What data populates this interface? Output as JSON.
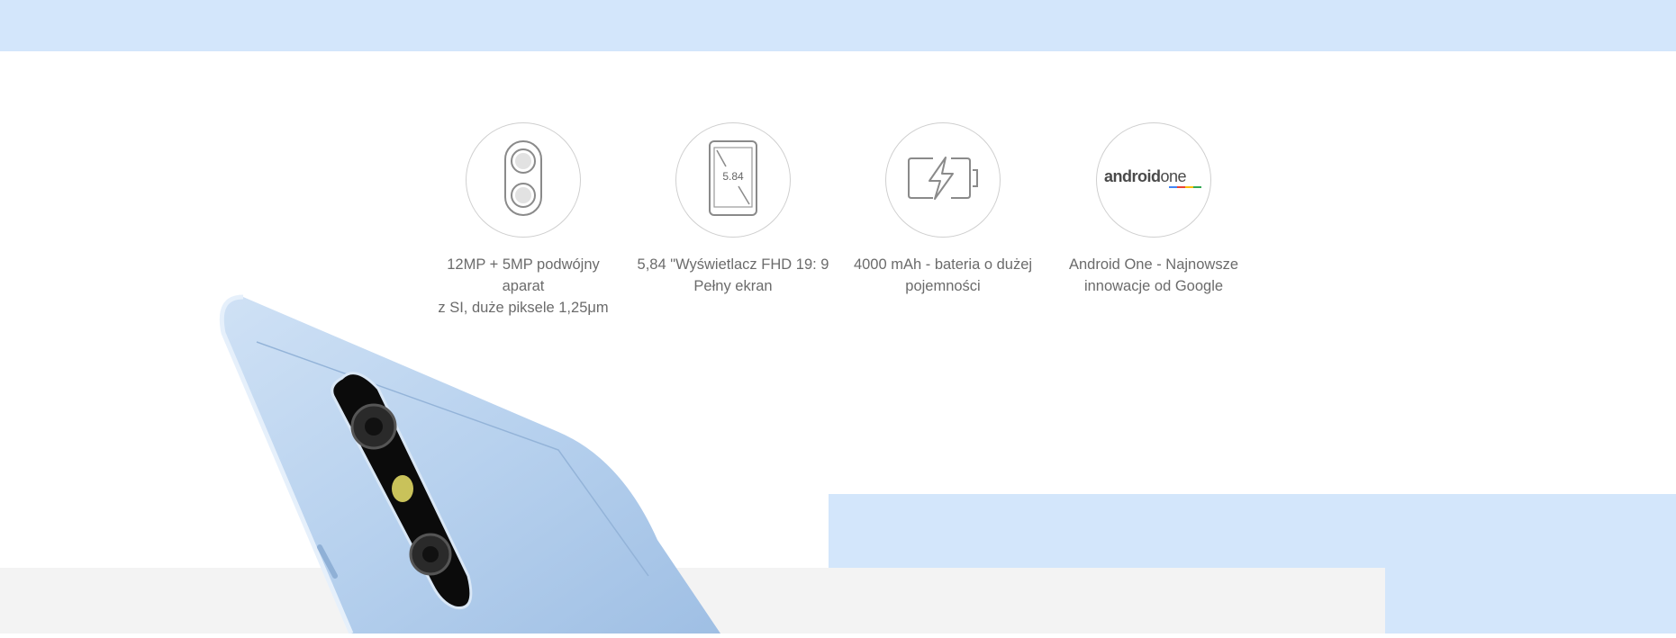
{
  "colors": {
    "band": "#d3e6fb",
    "phone_blue": "#a9c8ea",
    "text": "#6b6b6b"
  },
  "features": [
    {
      "icon": "dual-camera-icon",
      "line1": "12MP + 5MP podwójny aparat",
      "line2": "z SI, duże piksele 1,25μm"
    },
    {
      "icon": "screen-size-icon",
      "screen_label": "5.84",
      "line1": "5,84 \"Wyświetlacz FHD 19: 9",
      "line2": "Pełny ekran"
    },
    {
      "icon": "battery-charge-icon",
      "line1": "4000 mAh - bateria o dużej",
      "line2": "pojemności"
    },
    {
      "icon": "android-one-logo",
      "logo_text_a": "android",
      "logo_text_b": "one",
      "line1": "Android One - Najnowsze",
      "line2": "innowacje od Google"
    }
  ]
}
